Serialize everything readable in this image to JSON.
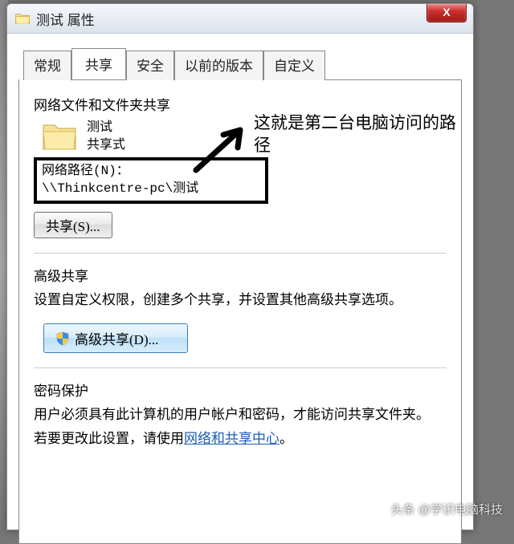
{
  "titlebar": {
    "title": "测试 属性",
    "close": "X"
  },
  "tabs": {
    "t0": "常规",
    "t1": "共享",
    "t2": "安全",
    "t3": "以前的版本",
    "t4": "自定义"
  },
  "share": {
    "section_title": "网络文件和文件夹共享",
    "folder_name": "测试",
    "share_mode": "共享式",
    "path_label": "网络路径(N)：",
    "path_value": "\\\\Thinkcentre-pc\\测试",
    "share_btn": "共享(S)..."
  },
  "advanced": {
    "section_title": "高级共享",
    "desc": "设置自定义权限，创建多个共享，并设置其他高级共享选项。",
    "btn": "高级共享(D)..."
  },
  "password": {
    "section_title": "密码保护",
    "line1": "用户必须具有此计算机的用户帐户和密码，才能访问共享文件夹。",
    "line2_a": "若要更改此设置，请使用",
    "link": "网络和共享中心",
    "line2_b": "。"
  },
  "annotation": {
    "line1": "这就是第二台电脑访问的路",
    "line2": "径"
  },
  "watermark": "头条 @学识电脑科技"
}
